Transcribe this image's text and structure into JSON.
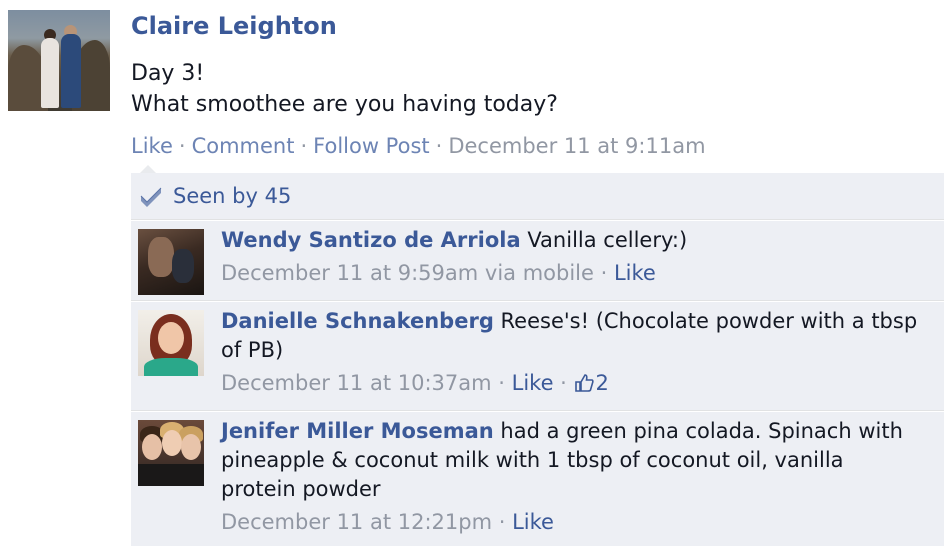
{
  "post": {
    "author": "Claire Leighton",
    "lines": [
      "Day 3!",
      "What smoothee are you having today?"
    ],
    "actions": {
      "like": "Like",
      "comment": "Comment",
      "follow": "Follow Post",
      "timestamp": "December 11 at 9:11am"
    }
  },
  "seen": {
    "label": "Seen by 45"
  },
  "comments": [
    {
      "name": "Wendy Santizo de Arriola",
      "text": " Vanilla cellery:)",
      "meta": "December 11 at 9:59am via mobile",
      "like": "Like",
      "likes_count": ""
    },
    {
      "name": "Danielle Schnakenberg",
      "text": " Reese's! (Chocolate powder with a tbsp of PB)",
      "meta": "December 11 at 10:37am",
      "like": "Like",
      "likes_count": "2"
    },
    {
      "name": "Jenifer Miller Moseman",
      "text": " had a green pina colada. Spinach with pineapple & coconut milk with 1 tbsp of coconut oil, vanilla protein powder",
      "meta": "December 11 at 12:21pm",
      "like": "Like",
      "likes_count": ""
    }
  ],
  "colors": {
    "link": "#3b5998",
    "action_link": "#6d84b4",
    "muted": "#9197a3",
    "panel": "#edeff4"
  }
}
